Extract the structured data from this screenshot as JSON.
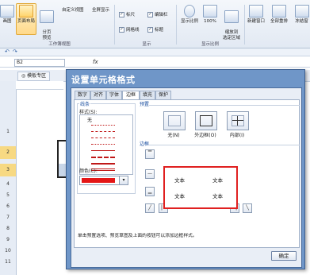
{
  "ribbon": {
    "buttons": [
      {
        "label": "画图"
      },
      {
        "label": "页面布局"
      },
      {
        "label": "分页\n预览"
      },
      {
        "label": "自定义视图"
      },
      {
        "label": "全屏显示"
      },
      {
        "label": "显示比例"
      },
      {
        "label": "100%"
      },
      {
        "label": "缩放到\n选定区域"
      },
      {
        "label": "新建窗口"
      },
      {
        "label": "全部重排"
      },
      {
        "label": "冻结窗"
      }
    ],
    "checks": [
      {
        "label": "标尺",
        "checked": true
      },
      {
        "label": "编辑栏",
        "checked": true
      },
      {
        "label": "网格线",
        "checked": true
      },
      {
        "label": "标题",
        "checked": true
      }
    ],
    "groups": {
      "workbook_views": "工作簿视图",
      "show": "显示",
      "zoom": "显示比例"
    }
  },
  "formula_bar": {
    "name_box": "B2",
    "fx": "fx"
  },
  "sheet": {
    "tab_label": "模板专区",
    "row_numbers": [
      "1",
      "2",
      "3",
      "4",
      "5",
      "6",
      "7",
      "8",
      "9",
      "10",
      "11"
    ]
  },
  "dialog": {
    "title": "设置单元格格式",
    "tabs": [
      "数字",
      "对齐",
      "字体",
      "边框",
      "填充",
      "保护"
    ],
    "active_tab": "边框",
    "line_group": "线条",
    "style_label": "样式(S):",
    "none_label": "无",
    "color_label": "颜色(C):",
    "color_value": "#e41616",
    "presets_group": "预置",
    "presets": [
      "无(N)",
      "外边框(O)",
      "内部(I)"
    ],
    "border_group": "边框",
    "preview_text": [
      "文本",
      "文本",
      "文本",
      "文本"
    ],
    "hint": "单击预置选项、预览草图及上面的按钮可以添加边框样式。",
    "ok_label": "确定"
  }
}
